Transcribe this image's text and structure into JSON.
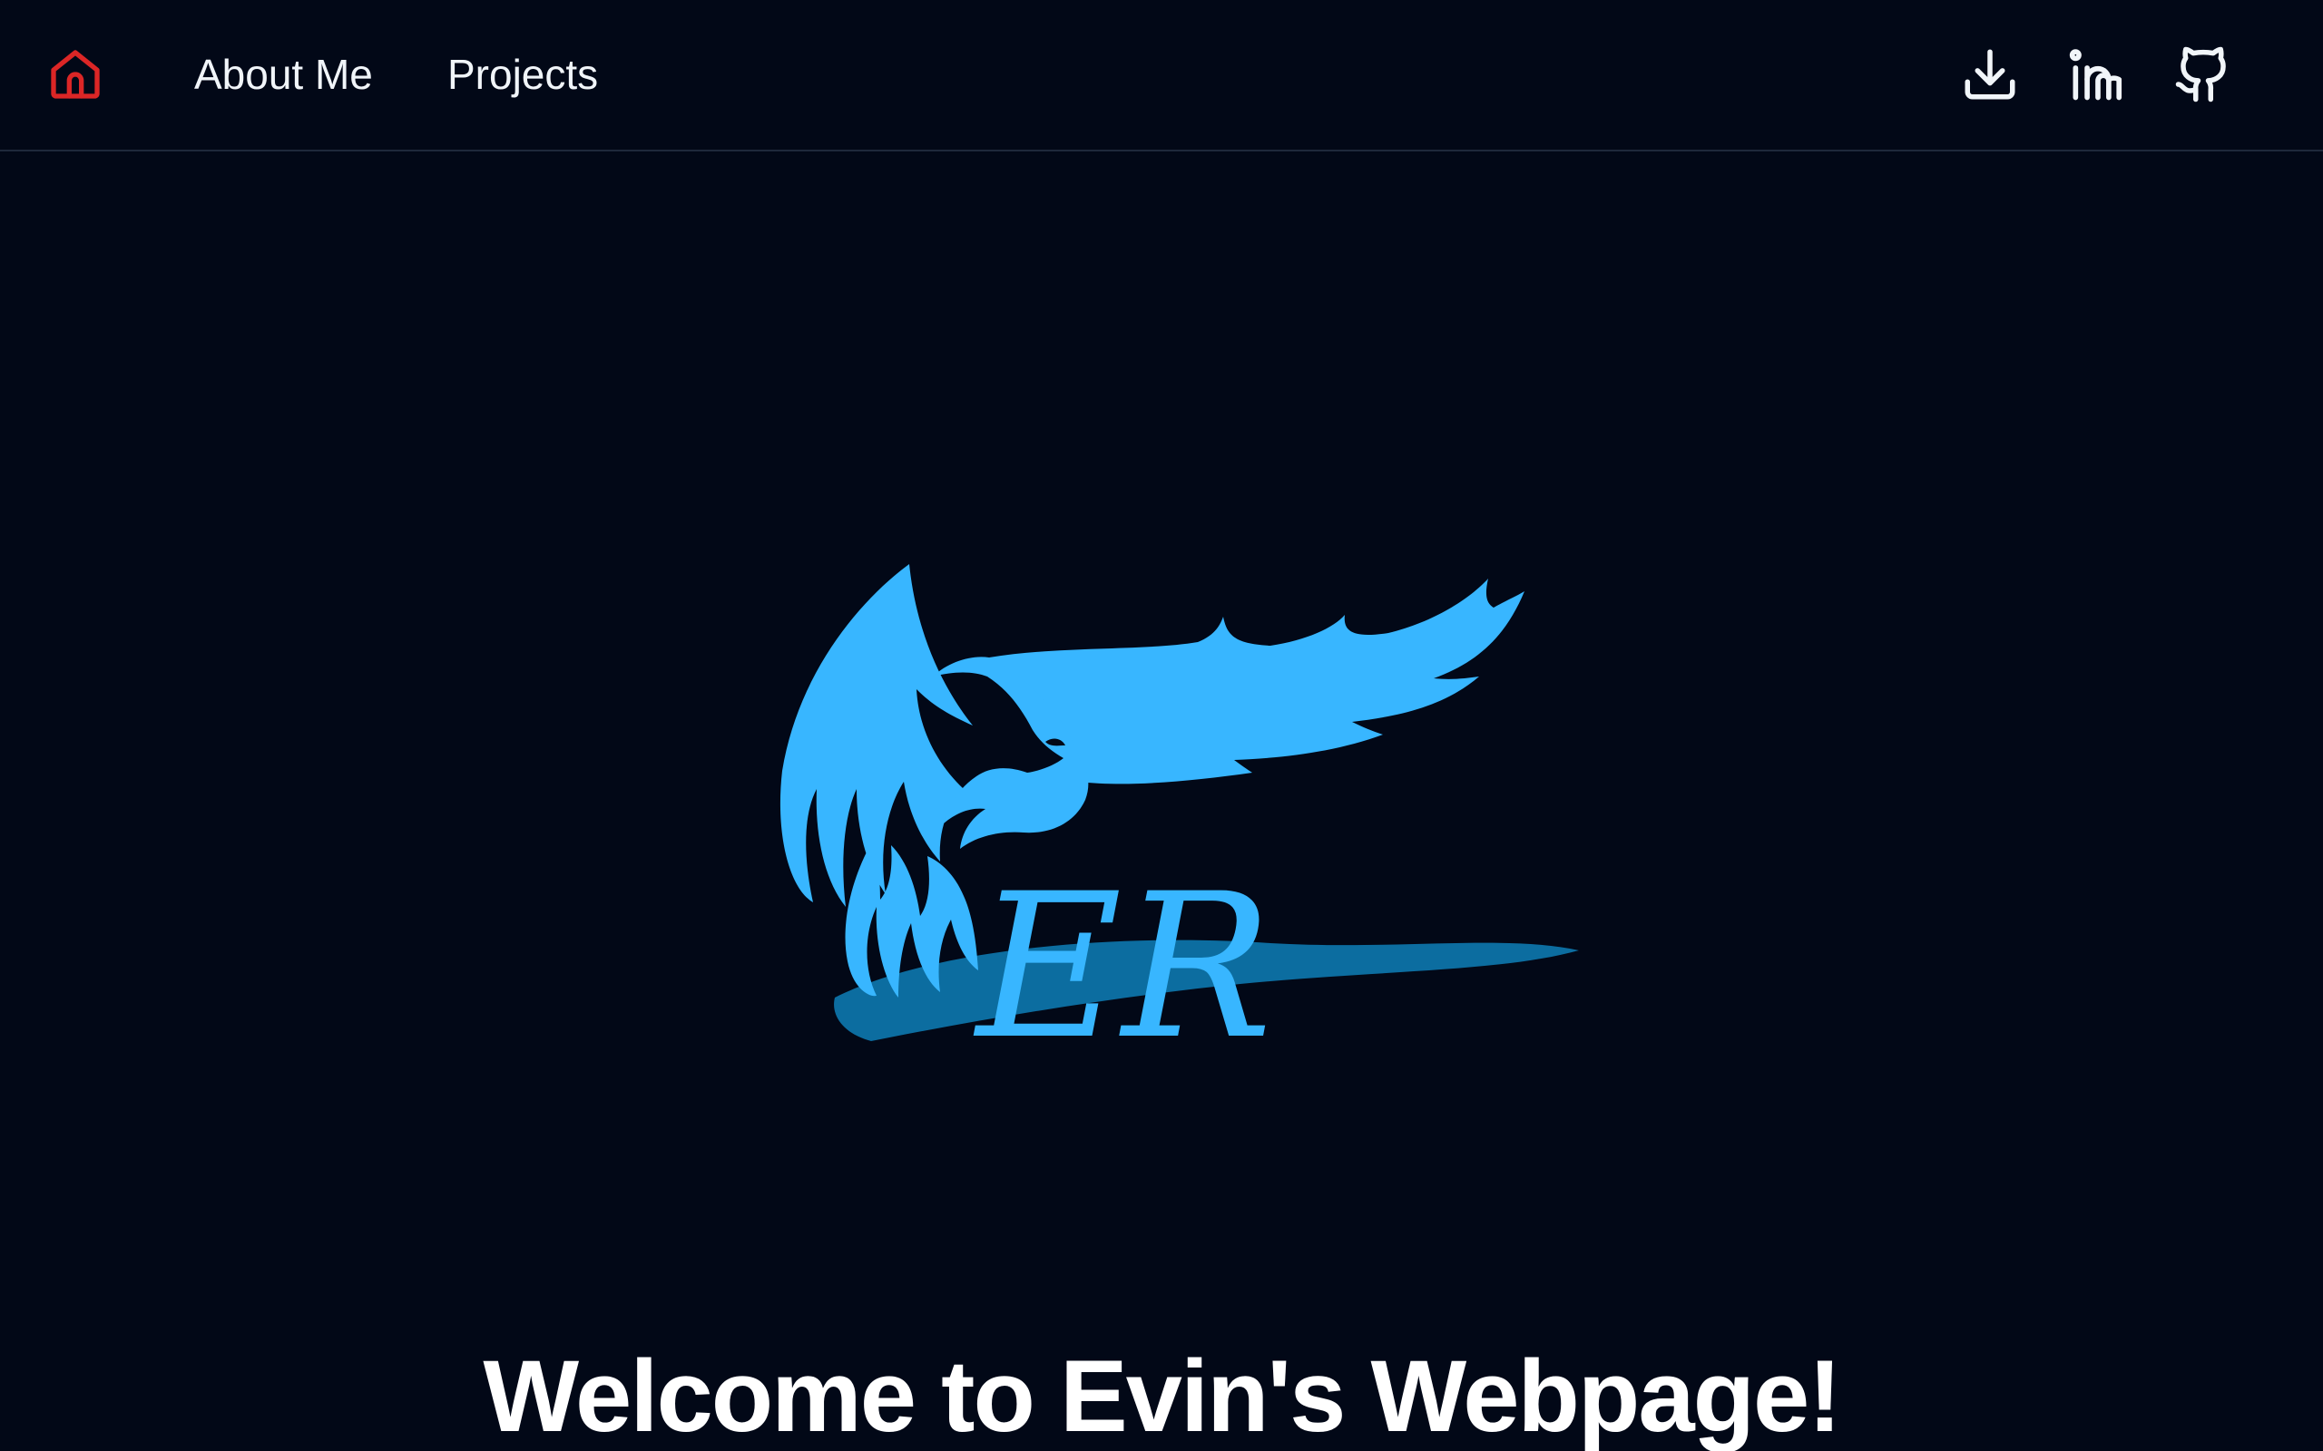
{
  "theme": {
    "background": "#020817",
    "accent_home": "#dc2626",
    "logo_color": "#38b6ff",
    "logo_shadow": "#0e7fb8",
    "text": "#f8fafc"
  },
  "nav": {
    "home_icon": "home-icon",
    "links": [
      {
        "label": "About Me"
      },
      {
        "label": "Projects"
      }
    ],
    "actions": [
      {
        "icon": "download-icon"
      },
      {
        "icon": "linkedin-icon"
      },
      {
        "icon": "github-icon"
      }
    ]
  },
  "hero": {
    "logo_letters": "ER",
    "title": "Welcome to Evin's Webpage!"
  }
}
